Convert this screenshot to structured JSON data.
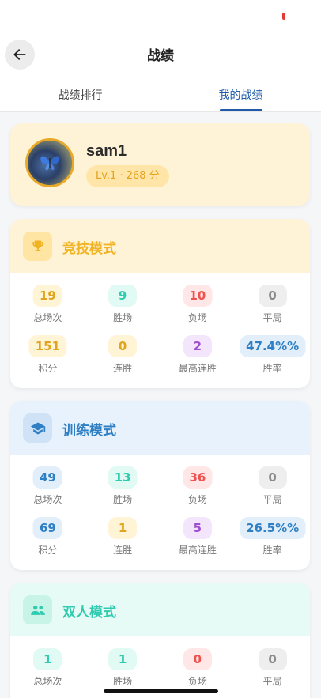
{
  "header": {
    "title": "战绩",
    "back_icon": "arrow-left-icon"
  },
  "tabs": [
    {
      "label": "战绩排行",
      "active": false
    },
    {
      "label": "我的战绩",
      "active": true
    }
  ],
  "profile": {
    "username": "sam1",
    "level": "Lv.1 · 268 分"
  },
  "modes": [
    {
      "title": "竞技模式",
      "icon": "trophy-icon",
      "accent": "#f0b323",
      "stats_row1": [
        {
          "value": "19",
          "label": "总场次"
        },
        {
          "value": "9",
          "label": "胜场"
        },
        {
          "value": "10",
          "label": "负场"
        },
        {
          "value": "0",
          "label": "平局"
        }
      ],
      "stats_row2": [
        {
          "value": "151",
          "label": "积分"
        },
        {
          "value": "0",
          "label": "连胜"
        },
        {
          "value": "2",
          "label": "最高连胜"
        },
        {
          "value": "47.4%%",
          "label": "胜率"
        }
      ]
    },
    {
      "title": "训练模式",
      "icon": "graduation-cap-icon",
      "accent": "#2f7fc5",
      "stats_row1": [
        {
          "value": "49",
          "label": "总场次"
        },
        {
          "value": "13",
          "label": "胜场"
        },
        {
          "value": "36",
          "label": "负场"
        },
        {
          "value": "0",
          "label": "平局"
        }
      ],
      "stats_row2": [
        {
          "value": "69",
          "label": "积分"
        },
        {
          "value": "1",
          "label": "连胜"
        },
        {
          "value": "5",
          "label": "最高连胜"
        },
        {
          "value": "26.5%%",
          "label": "胜率"
        }
      ]
    },
    {
      "title": "双人模式",
      "icon": "people-icon",
      "accent": "#2ecbb0",
      "stats_row1": [
        {
          "value": "1",
          "label": "总场次"
        },
        {
          "value": "1",
          "label": "胜场"
        },
        {
          "value": "0",
          "label": "负场"
        },
        {
          "value": "0",
          "label": "平局"
        }
      ]
    }
  ]
}
